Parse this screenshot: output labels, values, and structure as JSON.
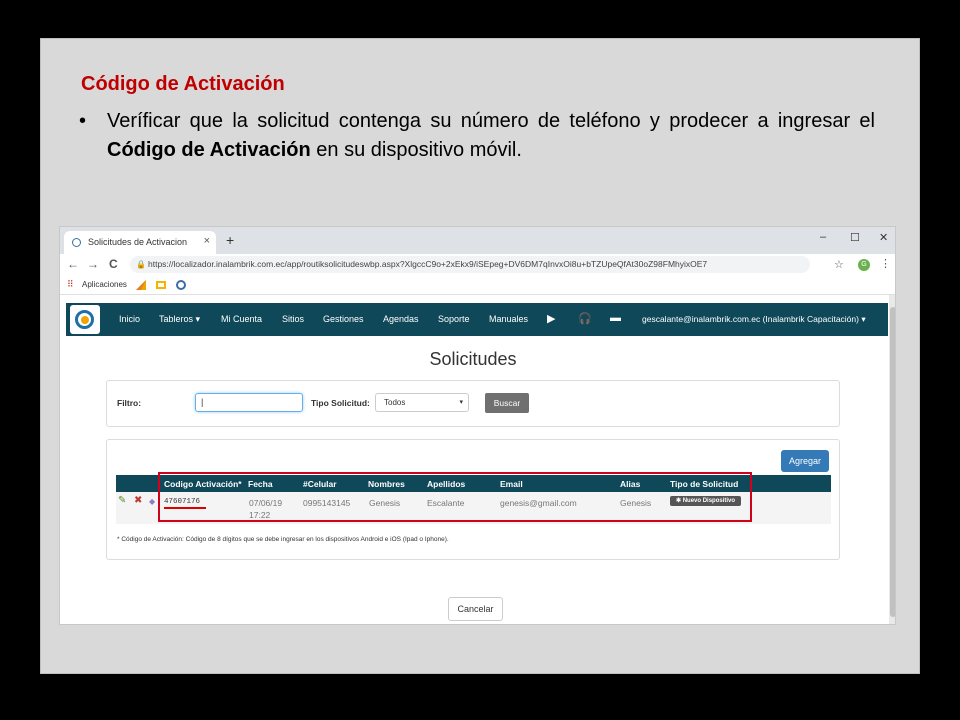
{
  "slide": {
    "title": "Código de Activación",
    "bullet_dot": "•",
    "bullet_part1": "Veríficar que la solicitud contenga su número de teléfono y prodecer a ingresar el ",
    "bullet_bold": "Código de Activación",
    "bullet_part2": " en su dispositivo móvil."
  },
  "browser": {
    "tab_title": "Solicitudes de Activacion",
    "tab_close": "×",
    "new_tab": "+",
    "minimize": "–",
    "maximize": "☐",
    "close": "✕",
    "back": "←",
    "forward": "→",
    "reload": "C",
    "lock": "🔒",
    "url": "https://localizador.inalambrik.com.ec/app/routiksolicitudeswbp.aspx?XlgccC9o+2xEkx9/iSEpeg+DV6DM7qInvxOi8u+bTZUpeQfAt30oZ98FMhyixOE7",
    "star": "☆",
    "profile_initial": "G",
    "menu": "⋮",
    "bookmarks_apps_icon": "⠿",
    "bookmarks_label": "Aplicaciones"
  },
  "navbar": {
    "items": [
      "Inicio",
      "Tableros ▾",
      "Mi Cuenta",
      "Sitios",
      "Gestiones",
      "Agendas",
      "Soporte",
      "Manuales"
    ],
    "youtube_icon": "▶",
    "support_icon": "🎧",
    "chat_icon": "▬",
    "user": "gescalante@inalambrik.com.ec (Inalambrik Capacitación) ▾"
  },
  "page": {
    "heading": "Solicitudes",
    "filter_label": "Filtro:",
    "filter_value": "|",
    "type_label": "Tipo Solicitud:",
    "type_value": "Todos",
    "type_caret": "▾",
    "search_button": "Buscar",
    "add_button": "Agregar",
    "cancel_button": "Cancelar",
    "note": "* Código de Activación: Código de 8 dígitos que se debe ingresar en los dispositivos Android e iOS (Ipad o Iphone)."
  },
  "table": {
    "headers": [
      "Codigo Activación*",
      "Fecha",
      "#Celular",
      "Nombres",
      "Apellidos",
      "Email",
      "Alias",
      "Tipo de Solicitud"
    ],
    "row": {
      "edit_icon": "✎",
      "delete_icon": "✖",
      "extra_icon": "◆",
      "code": "47607176",
      "date": "07/06/19",
      "time": "17:22",
      "phone": "0995143145",
      "names": "Genesis",
      "surnames": "Escalante",
      "email": "genesis@gmail.com",
      "alias": "Genesis",
      "type": "✱ Nuevo Dispositivo"
    }
  },
  "colors": {
    "slide_title": "#c00000",
    "navbar": "#0f4859",
    "highlight_box": "#d0021b",
    "primary_button": "#337ab7"
  }
}
